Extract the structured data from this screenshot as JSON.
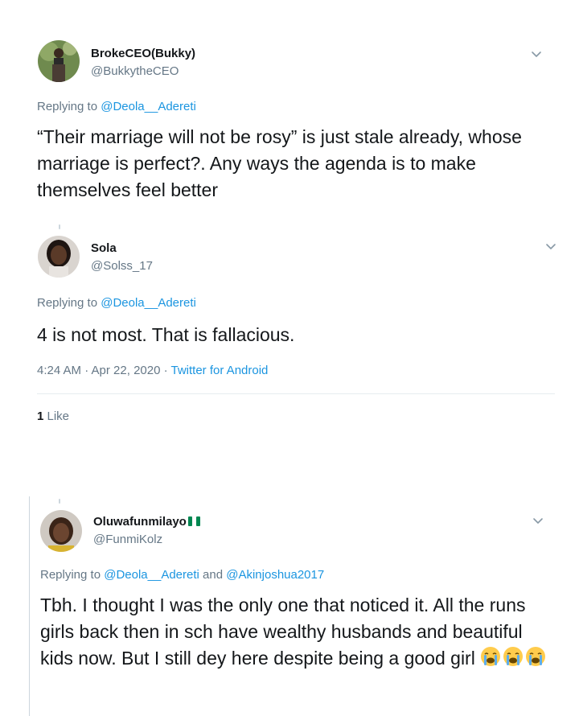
{
  "tweets": [
    {
      "name": "BrokeCEO(Bukky)",
      "handle": "@BukkytheCEO",
      "replying_prefix": "Replying to",
      "mention1": "@Deola__Adereti",
      "text": "“Their marriage will not be rosy” is just stale already, whose marriage is perfect?. Any ways the agenda is to make themselves feel better"
    },
    {
      "name": "Sola",
      "handle": "@Solss_17",
      "replying_prefix": "Replying to",
      "mention1": "@Deola__Adereti",
      "text": "4 is not most. That is fallacious.",
      "timestamp": "4:24 AM · Apr 22, 2020 · ",
      "source": "Twitter for Android",
      "like_count": "1",
      "like_label": " Like"
    },
    {
      "name": "Oluwafunmilayo",
      "handle": "@FunmiKolz",
      "replying_prefix": "Replying to",
      "mention1": "@Deola__Adereti",
      "connector": " and ",
      "mention2": "@Akinjoshua2017",
      "text": "Tbh. I thought I was the only one that noticed it. All the runs girls back then in sch have wealthy husbands and beautiful kids now. But I still dey here despite being a good girl "
    }
  ],
  "icons": {
    "more": "chevron-down-icon",
    "flag": "nigeria-flag-icon",
    "crying": "loudly-crying-face-icon"
  },
  "colors": {
    "link": "#1b95e0",
    "secondary": "#657786",
    "primary": "#14171a",
    "divider": "#e6ecf0",
    "flag_green": "#008751"
  }
}
